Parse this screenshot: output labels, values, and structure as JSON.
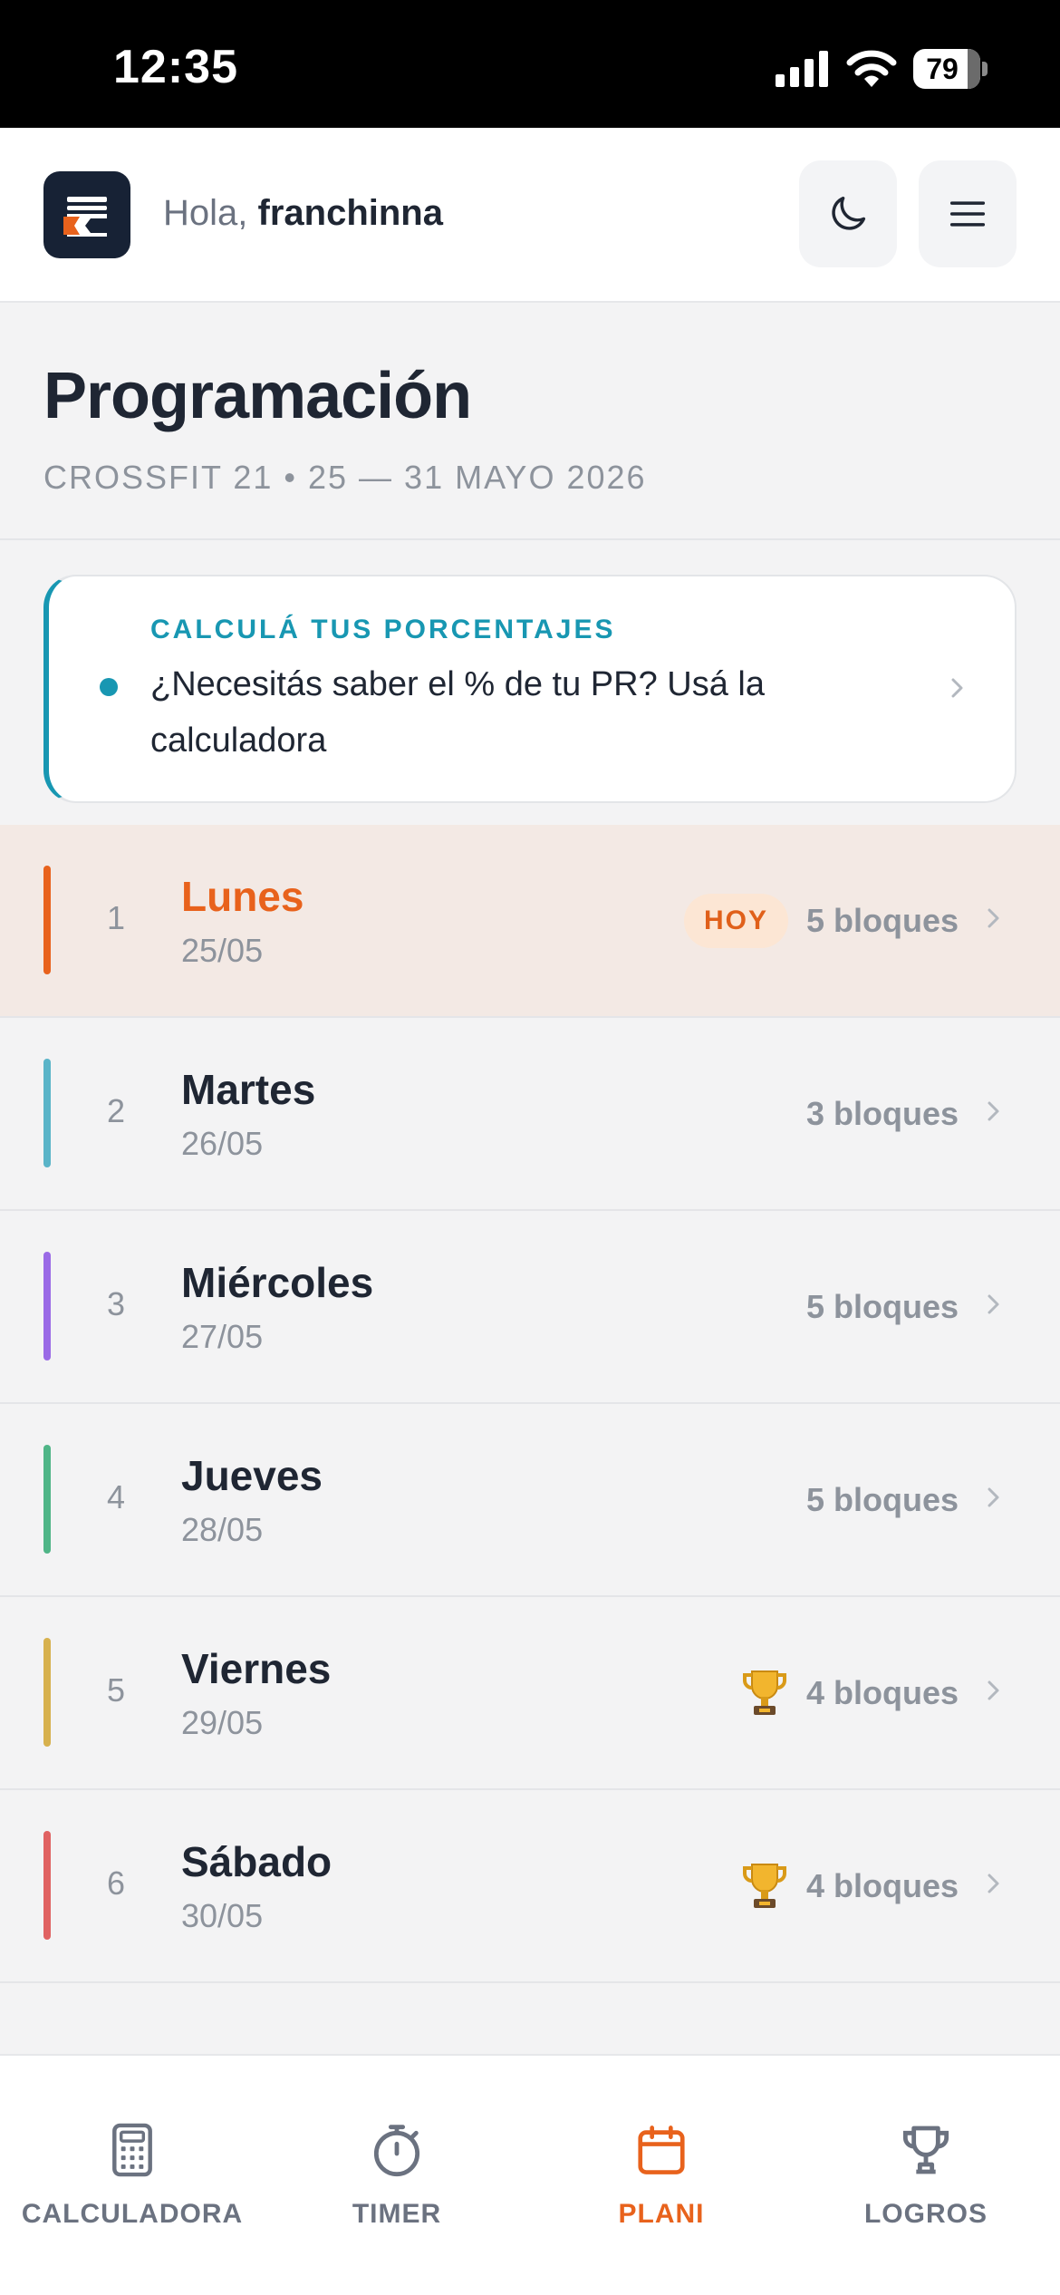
{
  "status_bar": {
    "time": "12:35",
    "battery": "79"
  },
  "header": {
    "greeting_prefix": "Hola, ",
    "user_name": "franchinna"
  },
  "page": {
    "title": "Programación",
    "subtitle": "CROSSFIT 21 • 25 — 31 MAYO 2026"
  },
  "promo": {
    "kicker": "CALCULÁ TUS PORCENTAJES",
    "text": "¿Necesitás saber el % de tu PR? Usá la calculadora"
  },
  "days": [
    {
      "num": "1",
      "name": "Lunes",
      "date": "25/05",
      "badge": "HOY",
      "trophy": false,
      "blocks": "5 bloques",
      "accent": "#e8621c"
    },
    {
      "num": "2",
      "name": "Martes",
      "date": "26/05",
      "badge": "",
      "trophy": false,
      "blocks": "3 bloques",
      "accent": "#5ab4c8"
    },
    {
      "num": "3",
      "name": "Miércoles",
      "date": "27/05",
      "badge": "",
      "trophy": false,
      "blocks": "5 bloques",
      "accent": "#9a6ae6"
    },
    {
      "num": "4",
      "name": "Jueves",
      "date": "28/05",
      "badge": "",
      "trophy": false,
      "blocks": "5 bloques",
      "accent": "#4fb587"
    },
    {
      "num": "5",
      "name": "Viernes",
      "date": "29/05",
      "badge": "",
      "trophy": true,
      "blocks": "4 bloques",
      "accent": "#d7b14e"
    },
    {
      "num": "6",
      "name": "Sábado",
      "date": "30/05",
      "badge": "",
      "trophy": true,
      "blocks": "4 bloques",
      "accent": "#e06262"
    }
  ],
  "tabs": [
    {
      "label": "CALCULADORA",
      "icon": "calculator-icon",
      "active": false
    },
    {
      "label": "TIMER",
      "icon": "stopwatch-icon",
      "active": false
    },
    {
      "label": "PLANI",
      "icon": "calendar-icon",
      "active": true
    },
    {
      "label": "LOGROS",
      "icon": "trophy-icon",
      "active": false
    }
  ],
  "colors": {
    "accent": "#e8621c",
    "teal": "#1897b2",
    "dark": "#1f2633"
  }
}
